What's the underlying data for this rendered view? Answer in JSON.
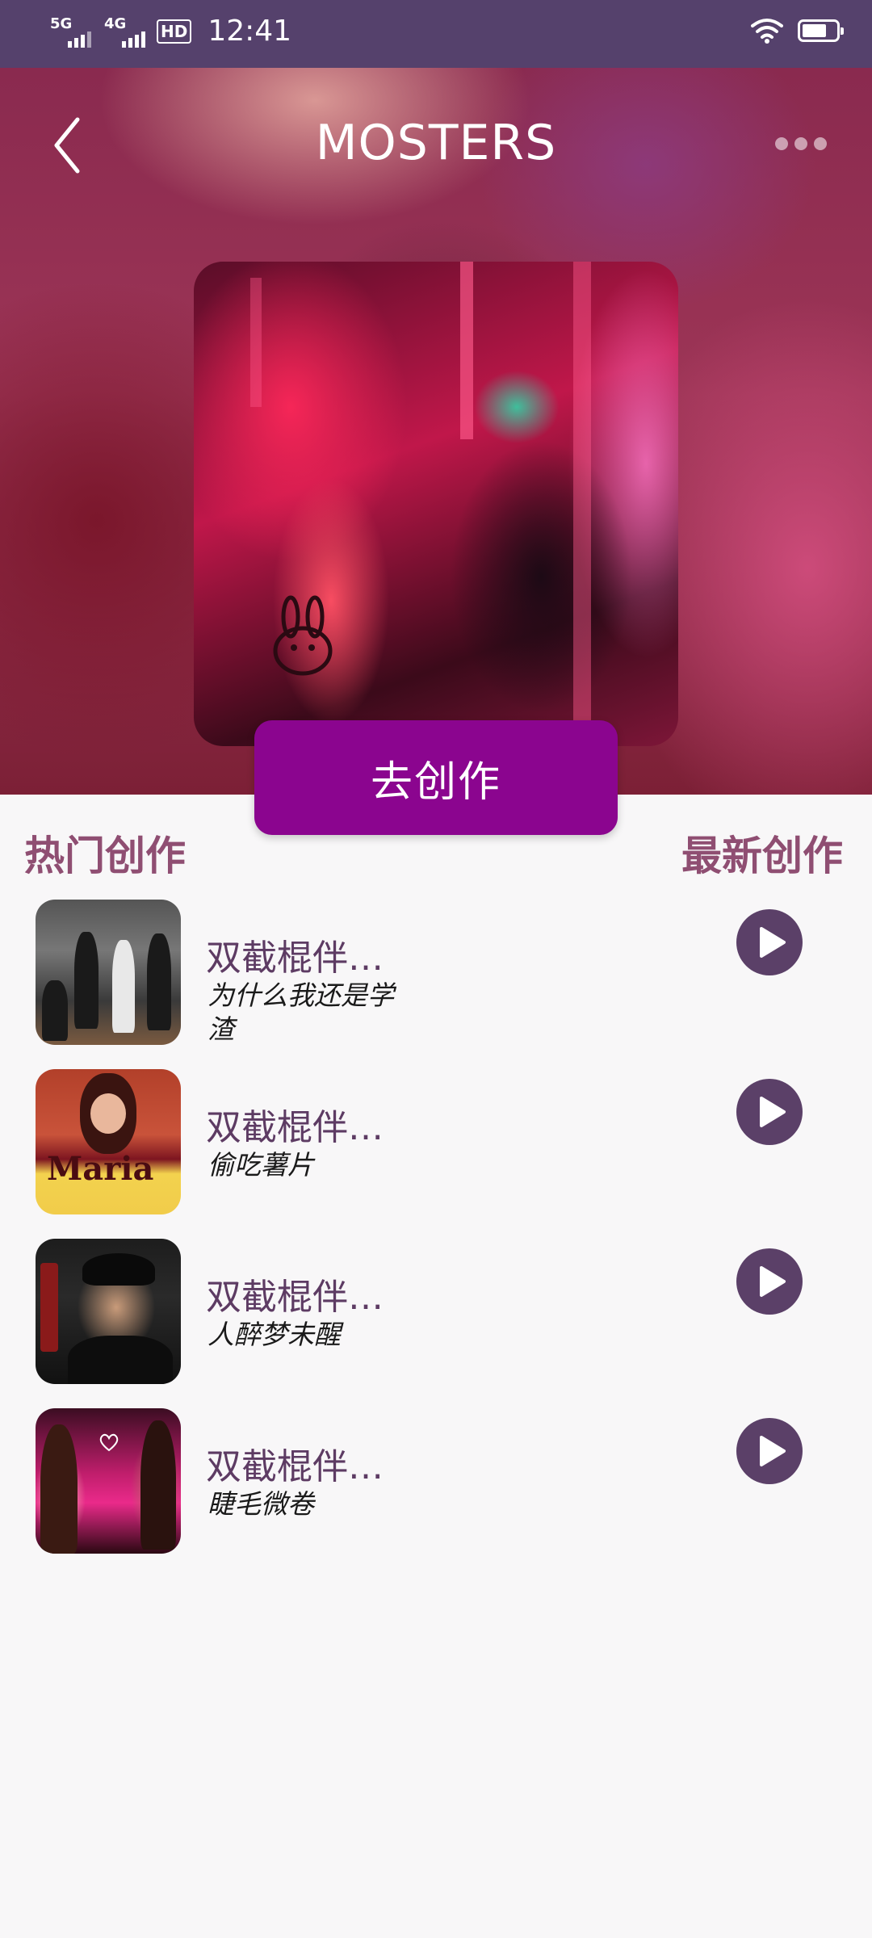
{
  "status_bar": {
    "sim1": "5G",
    "sim2": "4G",
    "hd": "HD",
    "time": "12:41"
  },
  "header": {
    "title": "MOSTERS"
  },
  "actions": {
    "create_label": "去创作"
  },
  "tabs": {
    "hot": "热门创作",
    "latest": "最新创作"
  },
  "songs": [
    {
      "title": "双截棍伴…",
      "subtitle": "为什么我还是学渣",
      "thumb_icon": "band-cover"
    },
    {
      "title": "双截棍伴…",
      "subtitle": "偷吃薯片",
      "thumb_icon": "maria-cover",
      "thumb_text": "Maria"
    },
    {
      "title": "双截棍伴…",
      "subtitle": "人醉梦未醒",
      "thumb_icon": "portrait-cover"
    },
    {
      "title": "双截棍伴…",
      "subtitle": "睫毛微卷",
      "thumb_icon": "duet-cover"
    }
  ],
  "colors": {
    "status_bar": "#55416c",
    "accent_button": "#8b058f",
    "tab_text": "#8f4e72",
    "play_button": "#5b4068"
  }
}
